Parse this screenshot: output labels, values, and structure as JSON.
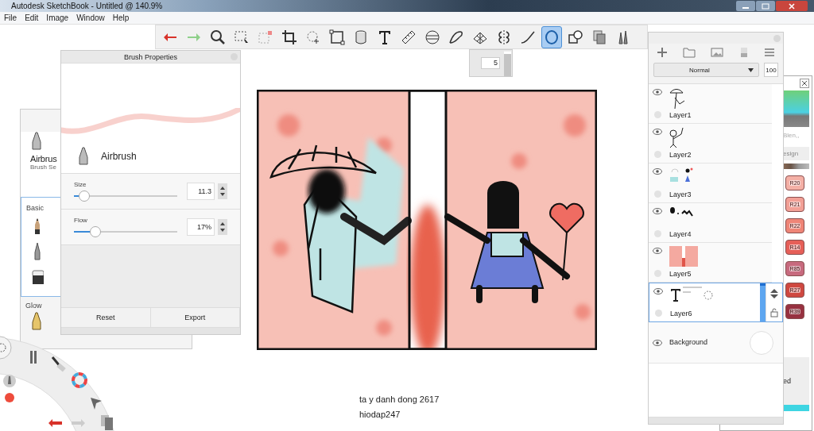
{
  "window": {
    "title": "Autodesk SketchBook - Untitled @ 140.9%"
  },
  "menu": [
    "File",
    "Edit",
    "Image",
    "Window",
    "Help"
  ],
  "toolbar": {
    "tools": [
      {
        "kind": "undo",
        "selected": false
      },
      {
        "kind": "redo",
        "selected": false
      },
      {
        "kind": "zoom",
        "selected": false
      },
      {
        "kind": "select",
        "selected": false
      },
      {
        "kind": "clear-select",
        "selected": false
      },
      {
        "kind": "crop",
        "selected": false
      },
      {
        "kind": "lasso",
        "selected": false
      },
      {
        "kind": "distort",
        "selected": false
      },
      {
        "kind": "fill",
        "selected": false
      },
      {
        "kind": "text",
        "selected": false
      },
      {
        "kind": "ruler",
        "selected": false
      },
      {
        "kind": "ellipse-guide",
        "selected": false
      },
      {
        "kind": "curve",
        "selected": false
      },
      {
        "kind": "perspective",
        "selected": false
      },
      {
        "kind": "symmetry",
        "selected": false
      },
      {
        "kind": "stroke",
        "selected": false
      },
      {
        "kind": "ellipse",
        "selected": true
      },
      {
        "kind": "shapes",
        "selected": false
      },
      {
        "kind": "copy",
        "selected": false
      },
      {
        "kind": "brushes",
        "selected": false
      }
    ]
  },
  "brush_size_popup": {
    "value": "5",
    "level": 0.95
  },
  "brush_library": {
    "brush_name": "Airbrus",
    "subtitle": "Brush Se",
    "sections": [
      {
        "label": "Basic",
        "selected": true,
        "brushes": [
          {
            "kind": "pencil",
            "selected": false
          },
          {
            "kind": "pen",
            "selected": false
          },
          {
            "kind": "eraser",
            "selected": false
          }
        ]
      },
      {
        "label": "Glow",
        "selected": false,
        "brushes": [
          {
            "kind": "glow",
            "selected": false
          }
        ]
      }
    ]
  },
  "brush_properties": {
    "title": "Brush Properties",
    "brush_name": "Airbrush",
    "sliders": [
      {
        "label": "Size",
        "level": 0.05,
        "value": "11.3"
      },
      {
        "label": "Flow",
        "level": 0.17,
        "value": "17%"
      }
    ],
    "buttons": [
      "Reset",
      "Export"
    ]
  },
  "canvas_text": [
    "ta y danh dong 2617",
    "hiodap247"
  ],
  "layers_panel": {
    "blend_mode": "Normal",
    "opacity": "100",
    "layers": [
      {
        "name": "Layer1",
        "kind": "umbrella-figure",
        "visible": true,
        "selected": false
      },
      {
        "name": "Layer2",
        "kind": "balloon-figure",
        "visible": true,
        "selected": false
      },
      {
        "name": "Layer3",
        "kind": "color-fill",
        "visible": true,
        "selected": false
      },
      {
        "name": "Layer4",
        "kind": "ink",
        "visible": true,
        "selected": false
      },
      {
        "name": "Layer5",
        "kind": "background-panels",
        "visible": true,
        "selected": false
      },
      {
        "name": "Layer6",
        "kind": "text",
        "visible": true,
        "selected": true
      },
      {
        "name": "Background",
        "kind": "background",
        "visible": true,
        "selected": false
      }
    ]
  },
  "color_panel": {
    "blend_label": "Blen,,",
    "tab_label": "esign",
    "footer_label": "ed",
    "swatches": [
      {
        "label": "R20",
        "color": "#f4b0a6"
      },
      {
        "label": "R21",
        "color": "#f2a096"
      },
      {
        "label": "R22",
        "color": "#ef8577"
      },
      {
        "label": "R14",
        "color": "#e65f58"
      },
      {
        "label": "R85",
        "color": "#c76a7e"
      },
      {
        "label": "R27",
        "color": "#cf4840"
      },
      {
        "label": "R39",
        "color": "#973140"
      }
    ]
  }
}
